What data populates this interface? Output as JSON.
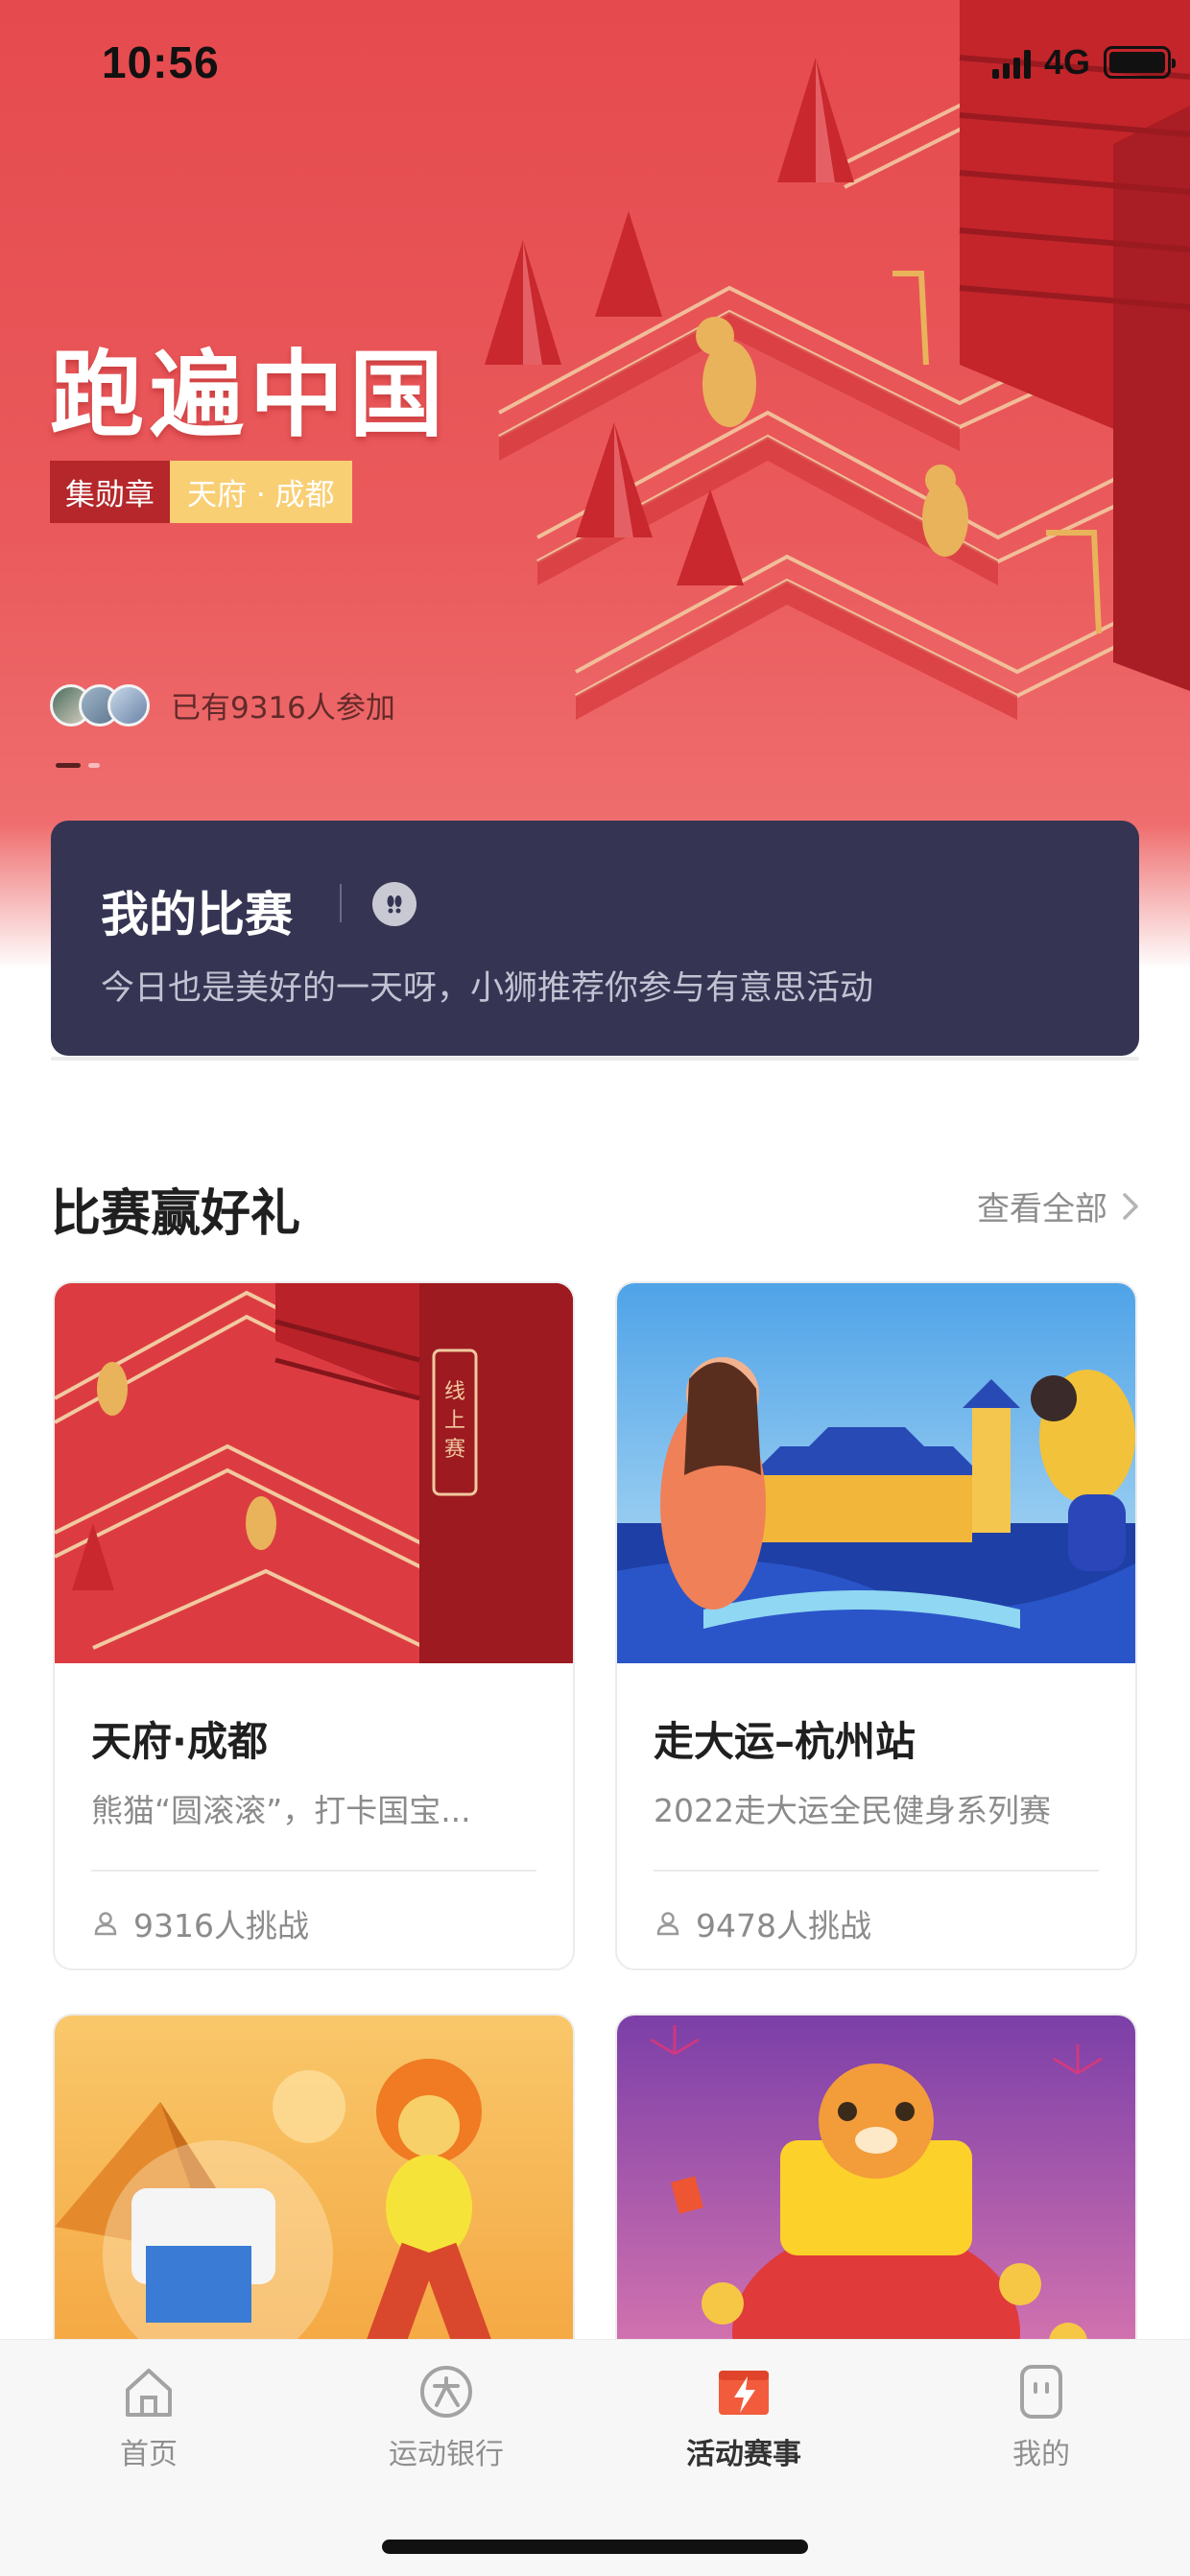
{
  "status_bar": {
    "time": "10:56",
    "network": "4G"
  },
  "hero": {
    "title": "跑遍中国",
    "tag_primary": "集勋章",
    "tag_secondary": "天府 · 成都",
    "participants": "已有9316人参加",
    "colors": {
      "background": "#e54a4e",
      "accent_gold": "#f9cf74"
    }
  },
  "my_competition": {
    "title": "我的比赛",
    "subtitle": "今日也是美好的一天呀，小狮推荐你参与有意思活动",
    "background_color": "#353553"
  },
  "section": {
    "title": "比赛赢好礼",
    "view_all": "查看全部"
  },
  "cards": [
    {
      "title": "天府·成都",
      "desc": "熊猫“圆滚滚”，打卡国宝...",
      "stats": "9316人挑战",
      "image_icon": "chengdu-city-illustration"
    },
    {
      "title": "走大运–杭州站",
      "desc": "2022走大运全民健身系列赛",
      "stats": "9478人挑战",
      "image_icon": "hangzhou-runner-illustration"
    },
    {
      "title": "",
      "desc": "",
      "stats": "",
      "image_icon": "lion-printer-illustration"
    },
    {
      "title": "",
      "desc": "",
      "stats": "",
      "image_icon": "tiger-gold-illustration"
    }
  ],
  "tabbar": {
    "items": [
      {
        "label": "首页",
        "icon": "home-icon"
      },
      {
        "label": "运动银行",
        "icon": "sport-bank-icon"
      },
      {
        "label": "活动赛事",
        "icon": "events-icon"
      },
      {
        "label": "我的",
        "icon": "profile-icon"
      }
    ],
    "active_index": 2,
    "active_color": "#f25c3c"
  }
}
